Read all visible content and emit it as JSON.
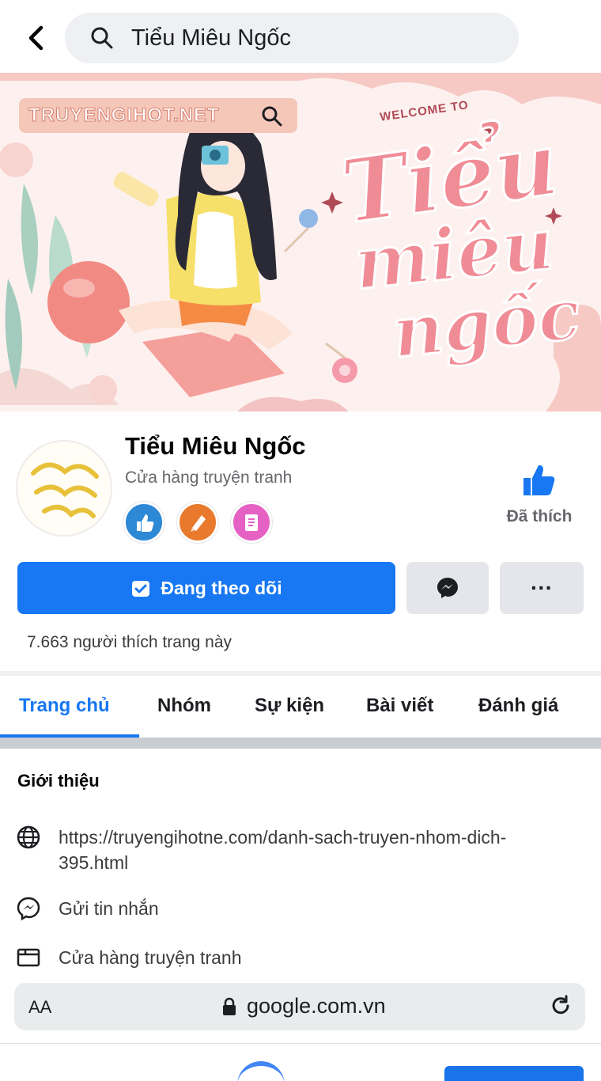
{
  "search": {
    "query": "Tiểu Miêu Ngốc"
  },
  "cover": {
    "site_badge": "TRUYENGIHOT.NET",
    "welcome": "WELCOME TO",
    "script_line1": "Tiểu",
    "script_line2": "miêu",
    "script_line3": "ngốc"
  },
  "profile": {
    "name": "Tiểu Miêu Ngốc",
    "category": "Cửa hàng truyện tranh",
    "badges": [
      "fans-badge-icon",
      "creator-badge-icon",
      "checklist-badge-icon"
    ],
    "liked_label": "Đã thích"
  },
  "actions": {
    "follow_label": "Đang theo dõi",
    "more_label": "···"
  },
  "likes_text": "7.663 người thích trang này",
  "tabs": [
    {
      "label": "Trang chủ",
      "active": true
    },
    {
      "label": "Nhóm",
      "active": false
    },
    {
      "label": "Sự kiện",
      "active": false
    },
    {
      "label": "Bài viết",
      "active": false
    },
    {
      "label": "Đánh giá",
      "active": false
    }
  ],
  "intro": {
    "title": "Giới thiệu",
    "website": "https://truyengihotne.com/danh-sach-truyen-nhom-dich-395.html",
    "message": "Gửi tin nhắn",
    "category": "Cửa hàng truyện tranh"
  },
  "browser": {
    "text_size": "AA",
    "url": "google.com.vn"
  },
  "colors": {
    "brand_blue": "#1877f2",
    "button_gray": "#e4e6eb",
    "cover_pink": "#f08c96"
  }
}
